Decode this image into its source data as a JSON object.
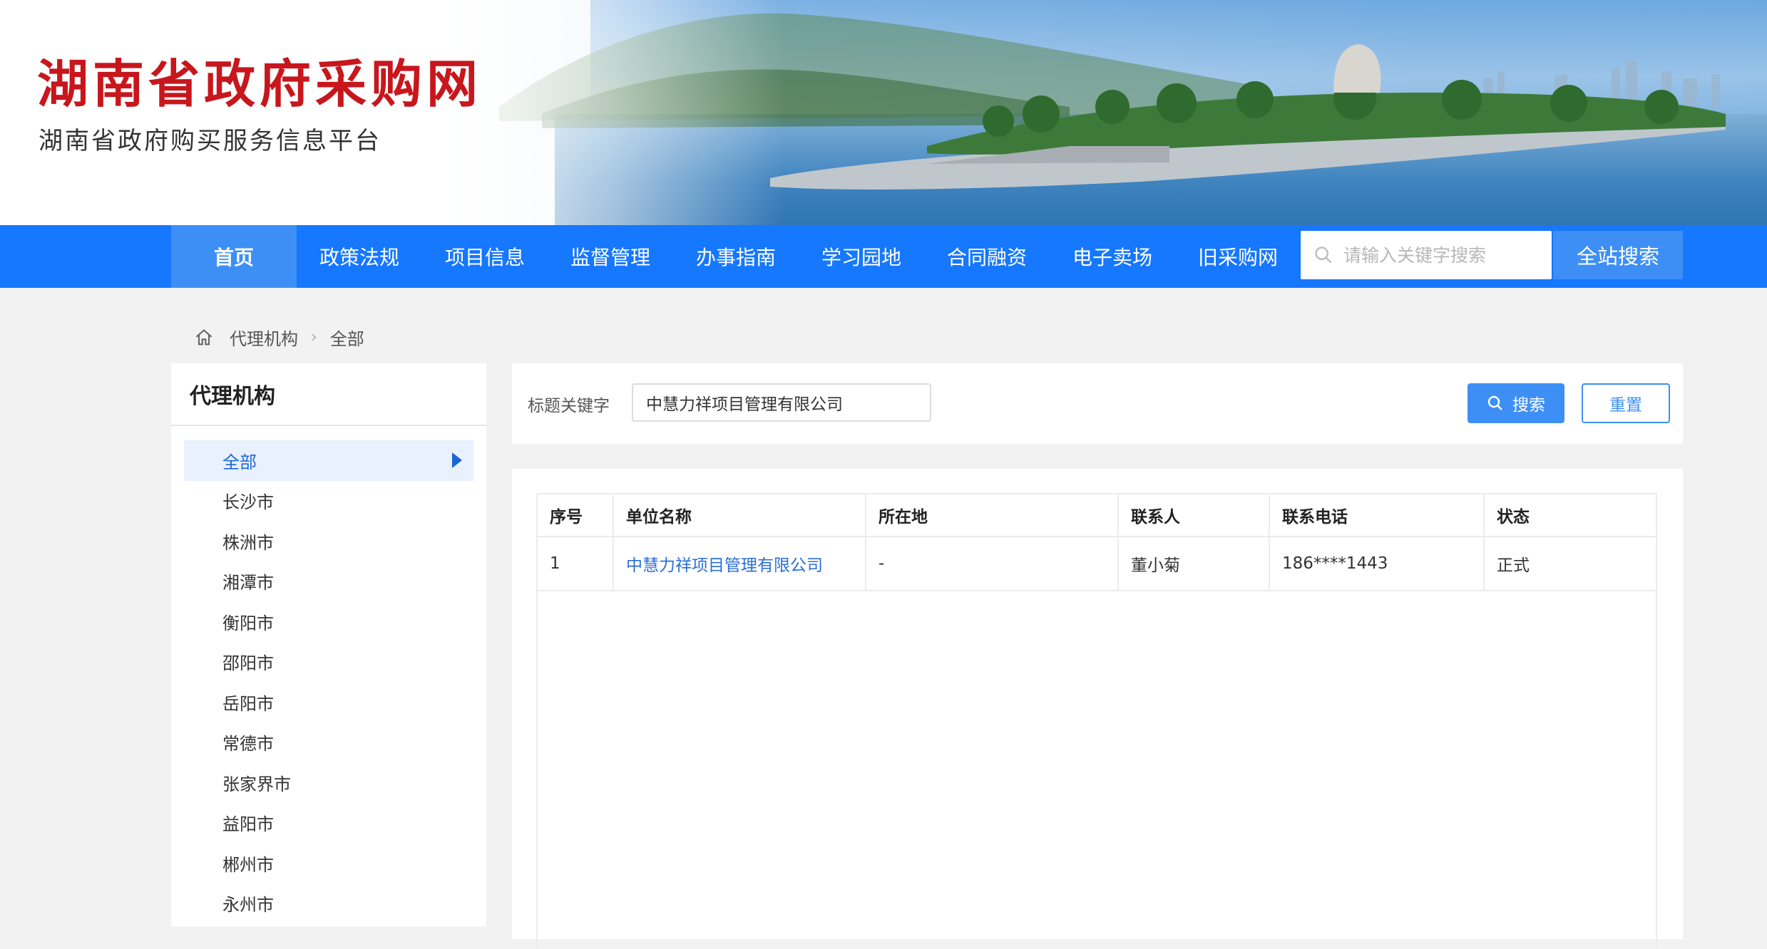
{
  "header": {
    "title": "湖南省政府采购网",
    "subtitle": "湖南省政府购买服务信息平台"
  },
  "nav": {
    "items": [
      {
        "label": "首页"
      },
      {
        "label": "政策法规"
      },
      {
        "label": "项目信息"
      },
      {
        "label": "监督管理"
      },
      {
        "label": "办事指南"
      },
      {
        "label": "学习园地"
      },
      {
        "label": "合同融资"
      },
      {
        "label": "电子卖场"
      },
      {
        "label": "旧采购网"
      }
    ],
    "active_index": 0,
    "search_placeholder": "请输入关键字搜索",
    "search_button": "全站搜索"
  },
  "breadcrumb": [
    "代理机构",
    "全部"
  ],
  "sidebar": {
    "title": "代理机构",
    "items": [
      {
        "label": "全部"
      },
      {
        "label": "长沙市"
      },
      {
        "label": "株洲市"
      },
      {
        "label": "湘潭市"
      },
      {
        "label": "衡阳市"
      },
      {
        "label": "邵阳市"
      },
      {
        "label": "岳阳市"
      },
      {
        "label": "常德市"
      },
      {
        "label": "张家界市"
      },
      {
        "label": "益阳市"
      },
      {
        "label": "郴州市"
      },
      {
        "label": "永州市"
      }
    ],
    "active_index": 0
  },
  "filter": {
    "label": "标题关键字",
    "value": "中慧力祥项目管理有限公司",
    "search_button": "搜索",
    "reset_button": "重置"
  },
  "table": {
    "columns": [
      "序号",
      "单位名称",
      "所在地",
      "联系人",
      "联系电话",
      "状态"
    ],
    "rows": [
      [
        "1",
        "中慧力祥项目管理有限公司",
        "-",
        "董小菊",
        "186****1443",
        "正式"
      ]
    ]
  },
  "colors": {
    "brand_red": "#c8161d",
    "nav_blue": "#1677ff",
    "accent_blue": "#3e8ff5",
    "link_blue": "#2a6fd6"
  }
}
